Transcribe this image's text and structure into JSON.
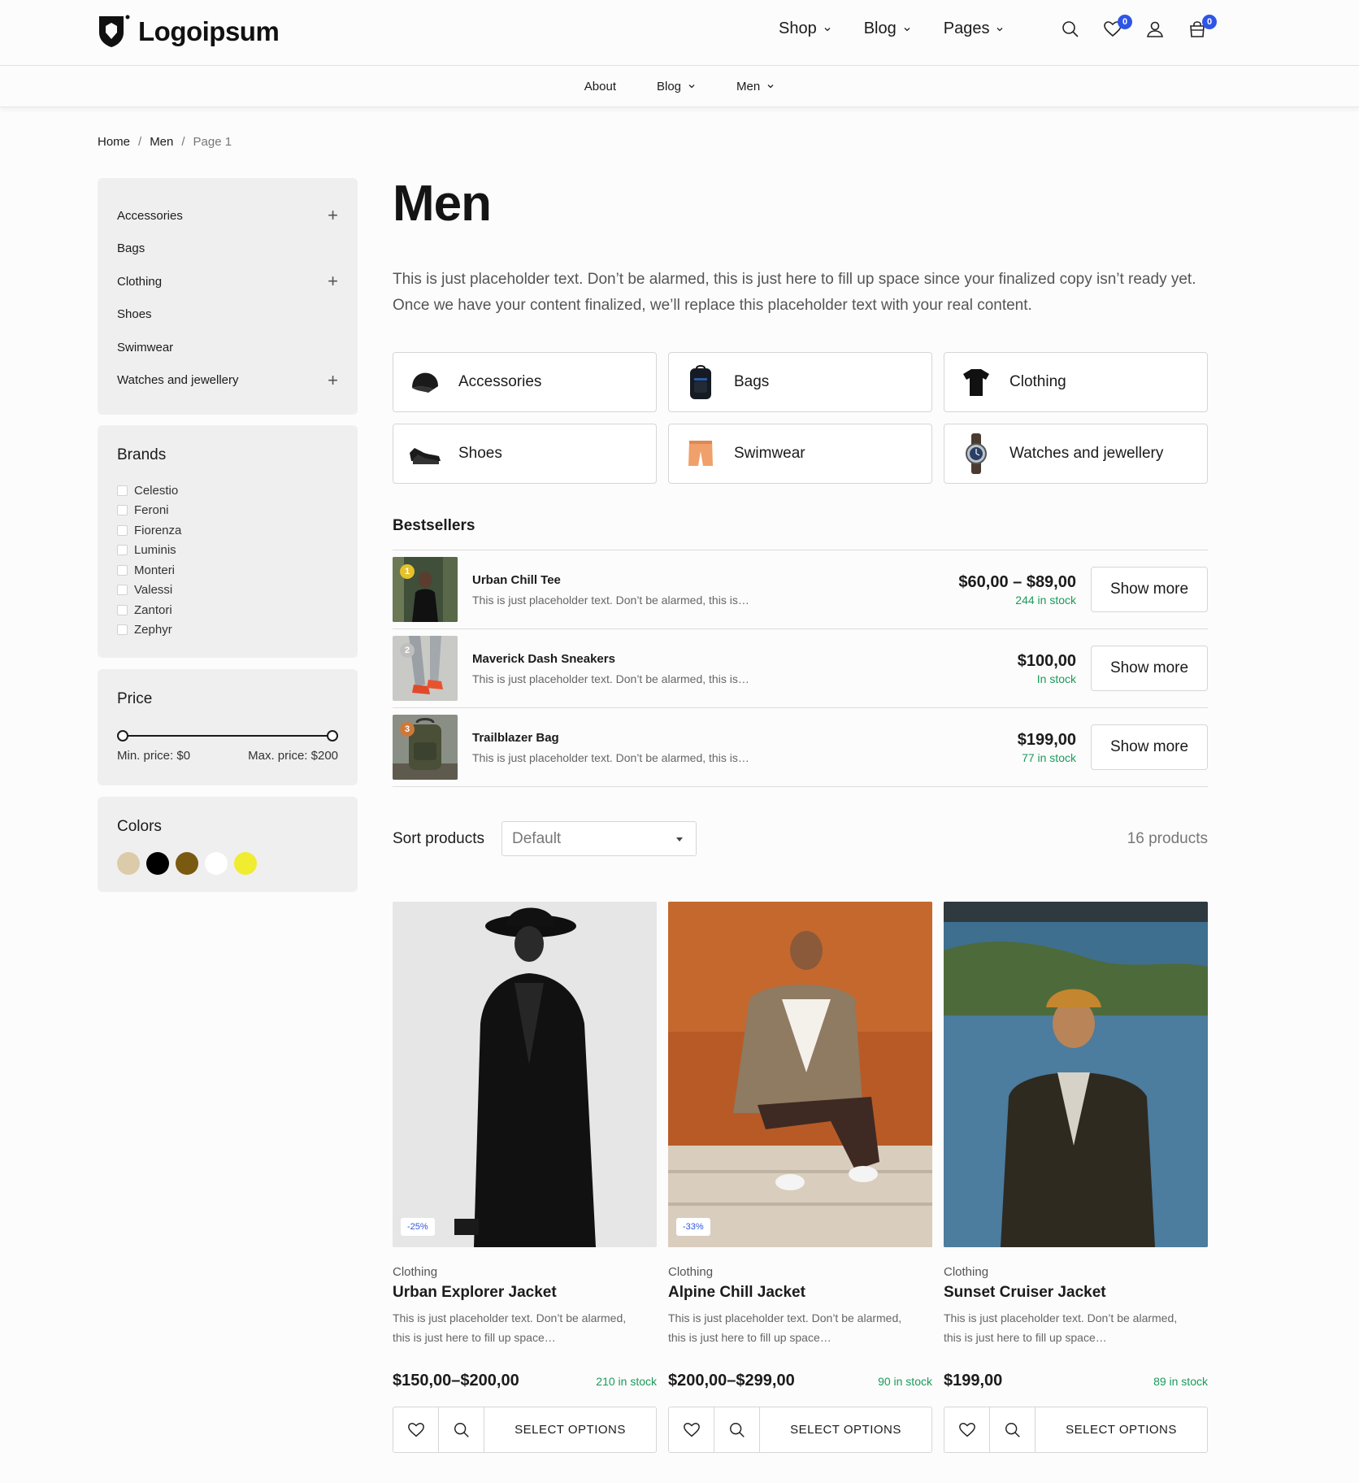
{
  "brand": {
    "name": "Logoipsum"
  },
  "main_nav": [
    {
      "label": "Shop"
    },
    {
      "label": "Blog"
    },
    {
      "label": "Pages"
    }
  ],
  "header_icons": {
    "wishlist_count": "0",
    "cart_count": "0"
  },
  "sub_nav": [
    {
      "label": "About"
    },
    {
      "label": "Blog"
    },
    {
      "label": "Men"
    }
  ],
  "breadcrumb": {
    "home": "Home",
    "section": "Men",
    "current": "Page 1"
  },
  "sidebar": {
    "categories": [
      {
        "label": "Accessories",
        "expandable": true
      },
      {
        "label": "Bags",
        "expandable": false
      },
      {
        "label": "Clothing",
        "expandable": true
      },
      {
        "label": "Shoes",
        "expandable": false
      },
      {
        "label": "Swimwear",
        "expandable": false
      },
      {
        "label": "Watches and jewellery",
        "expandable": true
      }
    ],
    "brands_title": "Brands",
    "brands": [
      "Celestio",
      "Feroni",
      "Fiorenza",
      "Luminis",
      "Monteri",
      "Valessi",
      "Zantori",
      "Zephyr"
    ],
    "price_title": "Price",
    "price_min_label": "Min. price: $0",
    "price_max_label": "Max. price: $200",
    "price_range": {
      "min": 0,
      "max": 200,
      "selected_min": 0,
      "selected_max": 200
    },
    "colors_title": "Colors",
    "colors": [
      "#dccba8",
      "#000000",
      "#7a5a10",
      "#ffffff",
      "#f0ec30"
    ]
  },
  "main": {
    "title": "Men",
    "intro": "This is just placeholder text. Don’t be alarmed, this is just here to fill up space since your finalized copy isn’t ready yet. Once we have your content finalized, we’ll replace this placeholder text with your real content.",
    "category_cards": [
      {
        "label": "Accessories",
        "icon": "cap-icon"
      },
      {
        "label": "Bags",
        "icon": "backpack-icon"
      },
      {
        "label": "Clothing",
        "icon": "tshirt-icon"
      },
      {
        "label": "Shoes",
        "icon": "shoe-icon"
      },
      {
        "label": "Swimwear",
        "icon": "shorts-icon"
      },
      {
        "label": "Watches and jewellery",
        "icon": "watch-icon"
      }
    ],
    "bestsellers_title": "Bestsellers",
    "bestsellers": [
      {
        "rank": "1",
        "name": "Urban Chill Tee",
        "desc": "This is just placeholder text. Don’t be alarmed, this is…",
        "price": "$60,00 – $89,00",
        "stock": "244 in stock",
        "button": "Show more"
      },
      {
        "rank": "2",
        "name": "Maverick Dash Sneakers",
        "desc": "This is just placeholder text. Don’t be alarmed, this is…",
        "price": "$100,00",
        "stock": "In stock",
        "button": "Show more"
      },
      {
        "rank": "3",
        "name": "Trailblazer Bag",
        "desc": "This is just placeholder text. Don’t be alarmed, this is…",
        "price": "$199,00",
        "stock": "77 in stock",
        "button": "Show more"
      }
    ],
    "sort_label": "Sort products",
    "sort_value": "Default",
    "product_count": "16 products",
    "products": [
      {
        "category": "Clothing",
        "name": "Urban Explorer Jacket",
        "desc": "This is just placeholder text. Don’t be alarmed, this is just here to fill up space…",
        "price": "$150,00–$200,00",
        "stock": "210 in stock",
        "discount": "-25%",
        "button": "SELECT OPTIONS"
      },
      {
        "category": "Clothing",
        "name": "Alpine Chill Jacket",
        "desc": "This is just placeholder text. Don’t be alarmed, this is just here to fill up space…",
        "price": "$200,00–$299,00",
        "stock": "90 in stock",
        "discount": "-33%",
        "button": "SELECT OPTIONS"
      },
      {
        "category": "Clothing",
        "name": "Sunset Cruiser Jacket",
        "desc": "This is just placeholder text. Don’t be alarmed, this is just here to fill up space…",
        "price": "$199,00",
        "stock": "89 in stock",
        "discount": "",
        "button": "SELECT OPTIONS"
      }
    ]
  },
  "colors": {
    "accent": "#2f55e6",
    "stock_green": "#1a9a5a",
    "panel_bg": "#efefef"
  }
}
